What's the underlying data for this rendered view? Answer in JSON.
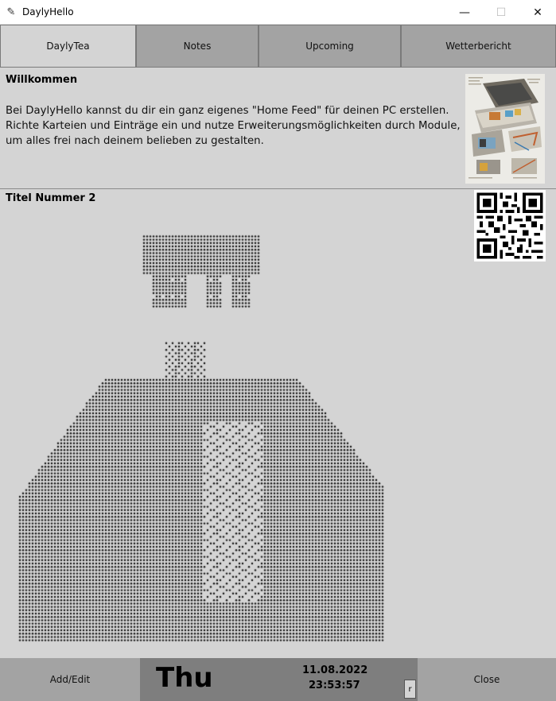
{
  "window": {
    "title": "DaylyHello",
    "icon": "feather-icon",
    "controls": {
      "minimize": "—",
      "maximize": "☐",
      "close": "✕"
    }
  },
  "tabs": [
    {
      "label": "DaylyTea",
      "active": true
    },
    {
      "label": "Notes",
      "active": false
    },
    {
      "label": "Upcoming",
      "active": false
    },
    {
      "label": "Wetterbericht",
      "active": false
    }
  ],
  "welcome": {
    "title": "Willkommen",
    "lines": [
      "Bei DaylyHello kannst du dir ein ganz eigenes \"Home Feed\" für deinen PC erstellen.",
      "Richte Karteien und Einträge ein und nutze Erweiterungsmöglichkeiten durch Module,",
      "um alles frei nach deinem belieben zu gestalten."
    ]
  },
  "second": {
    "title": "Titel Nummer 2"
  },
  "footer": {
    "add_edit": "Add/Edit",
    "day": "Thu",
    "date": "11.08.2022",
    "time": "23:53:57",
    "refresh": "r",
    "close": "Close"
  },
  "colors": {
    "tab_inactive": "#a3a3a3",
    "tab_active": "#d4d4d4",
    "background": "#d4d4d4",
    "clock_panel": "#7e7e7e"
  }
}
